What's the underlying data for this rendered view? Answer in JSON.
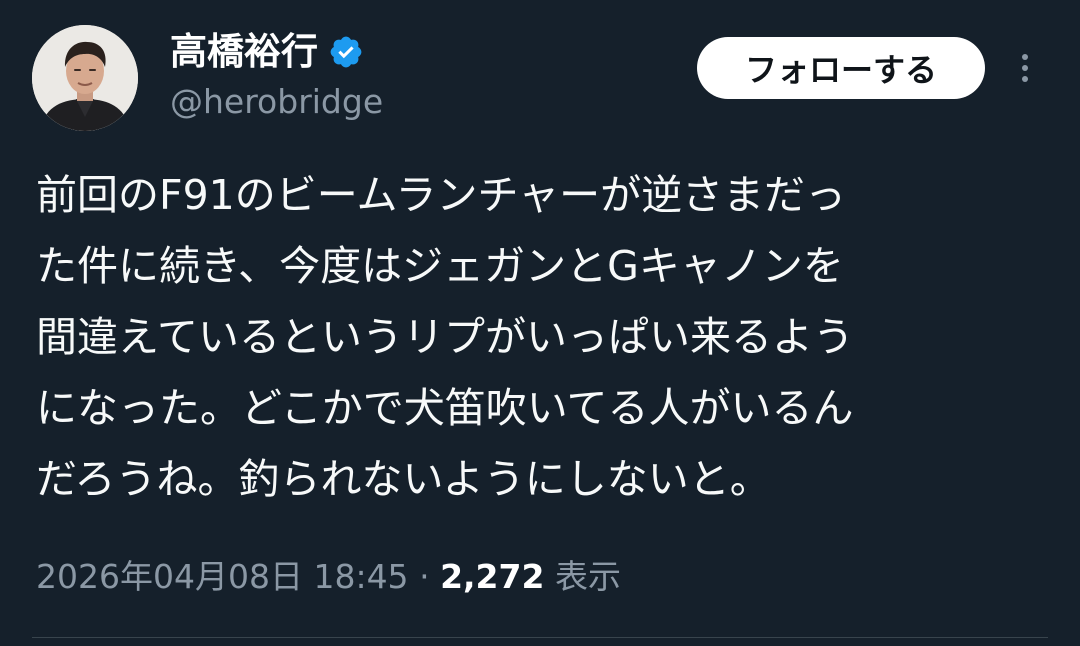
{
  "author": {
    "display_name": "高橋裕行",
    "handle": "@herobridge",
    "verified_icon": "verified-badge-icon",
    "avatar_icon": "user-avatar-photo"
  },
  "actions": {
    "follow_label": "フォローする",
    "more_icon": "more-vertical-icon"
  },
  "tweet": {
    "lines": [
      "前回のF91のビームランチャーが逆さまだっ",
      "た件に続き、今度はジェガンとGキャノンを",
      "間違えているというリプがいっぱい来るよう",
      "になった。どこかで犬笛吹いてる人がいるん",
      "だろうね。釣られないようにしないと。"
    ]
  },
  "meta": {
    "timestamp": "2026年04月08日 18:45",
    "separator": "·",
    "views_count": "2,272",
    "views_label": "表示"
  },
  "colors": {
    "background": "#15202b",
    "verified": "#1d9bf0",
    "secondary_text": "#8b98a5"
  }
}
